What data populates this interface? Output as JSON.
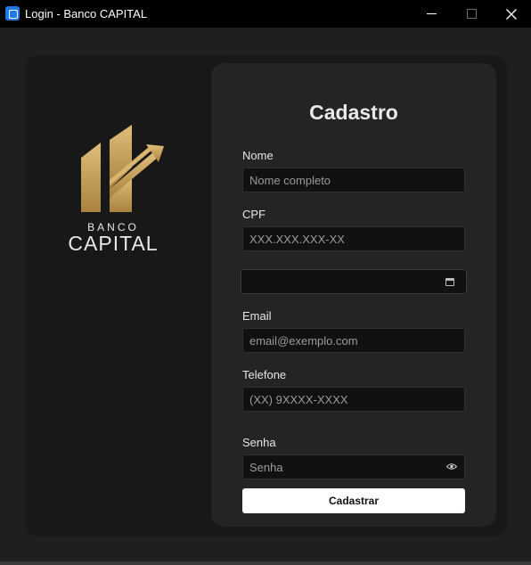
{
  "window": {
    "title": "Login - Banco CAPITAL",
    "minimize_icon": "minimize-icon",
    "maximize_icon": "maximize-icon",
    "close_icon": "close-icon"
  },
  "brand": {
    "line1": "BANCO",
    "line2": "CAPITAL",
    "logo_icon": "bank-growth-logo",
    "gold_color": "#C9A25B"
  },
  "form": {
    "title": "Cadastro",
    "fields": {
      "nome": {
        "label": "Nome",
        "placeholder": "Nome completo"
      },
      "cpf": {
        "label": "CPF",
        "placeholder": "XXX.XXX.XXX-XX"
      },
      "data": {
        "icon": "calendar-icon"
      },
      "email": {
        "label": "Email",
        "placeholder": "email@exemplo.com"
      },
      "telefone": {
        "label": "Telefone",
        "placeholder": "(XX) 9XXXX-XXXX"
      },
      "senha": {
        "label": "Senha",
        "placeholder": "Senha",
        "icon": "eye-icon"
      }
    },
    "submit_label": "Cadastrar"
  },
  "colors": {
    "background": "#1F1F1F",
    "panel": "#242424",
    "input": "#111111",
    "button": "#FFFFFF"
  }
}
